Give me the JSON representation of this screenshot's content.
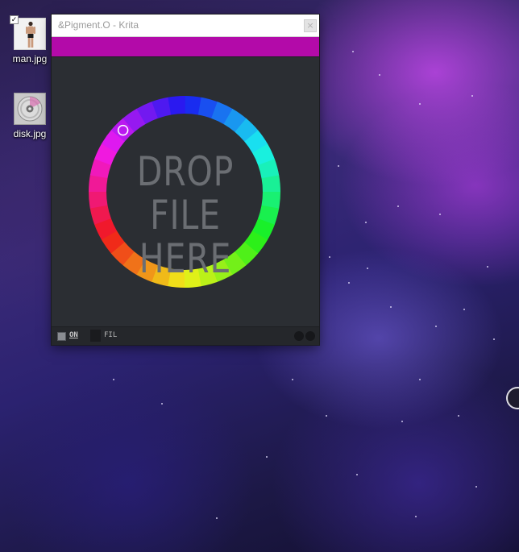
{
  "desktop": {
    "icons": [
      {
        "label": "man.jpg",
        "icon": "image-file-icon",
        "checked": true
      },
      {
        "label": "disk.jpg",
        "icon": "image-file-icon"
      }
    ]
  },
  "window": {
    "title": "&Pigment.O - Krita",
    "close_glyph": "×",
    "active_color": "#b30aa9",
    "drop_zone": {
      "lines": [
        "DROP",
        "FILE",
        "HERE"
      ]
    },
    "color_wheel": {
      "segments": 36,
      "cursor_hue_deg": 285
    },
    "statusbar": {
      "on_label": "ON",
      "fil_label": "FIL"
    }
  }
}
